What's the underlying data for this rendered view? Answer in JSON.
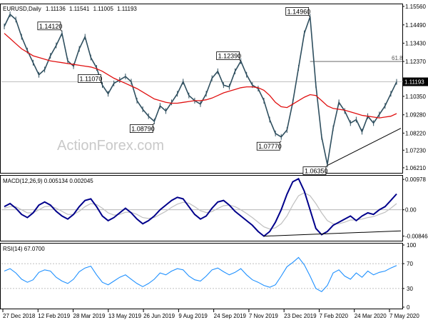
{
  "chart_data": [
    {
      "type": "candlestick",
      "title": "EURUSD,Daily",
      "ohlc": {
        "open": "1.11136",
        "high": "1.11541",
        "low": "1.11005",
        "close": "1.11193"
      },
      "y_ticks": [
        "1.15560",
        "1.14490",
        "1.13430",
        "1.12370",
        "1.11193",
        "1.10350",
        "1.09280",
        "1.08220",
        "1.07230",
        "1.06210"
      ],
      "ylim": [
        1.06,
        1.156
      ],
      "current_price": "1.11193",
      "fib_label": "61.8",
      "fib_level": 1.1237,
      "annotations": [
        {
          "label": "1.14120",
          "date_index": 2,
          "value": 1.1412
        },
        {
          "label": "1.11070",
          "date_index": 1,
          "value": 1.1107
        },
        {
          "label": "1.08790",
          "date_index": 6,
          "value": 1.0879
        },
        {
          "label": "1.12390",
          "date_index": 9,
          "value": 1.1239
        },
        {
          "label": "1.14960",
          "date_index": 11,
          "value": 1.1496
        },
        {
          "label": "1.07770",
          "date_index": 11,
          "value": 1.0777
        },
        {
          "label": "1.06350",
          "date_index": 12,
          "value": 1.0635
        }
      ],
      "series": [
        {
          "name": "",
          "kind": "price",
          "values": [
            1.144,
            1.151,
            1.148,
            1.138,
            1.13,
            1.123,
            1.116,
            1.119,
            1.127,
            1.133,
            1.14,
            1.124,
            1.121,
            1.131,
            1.138,
            1.126,
            1.12,
            1.11,
            1.105,
            1.111,
            1.113,
            1.115,
            1.112,
            1.101,
            1.096,
            1.092,
            1.089,
            1.098,
            1.095,
            1.1,
            1.105,
            1.112,
            1.104,
            1.101,
            1.099,
            1.105,
            1.114,
            1.118,
            1.11,
            1.109,
            1.118,
            1.1239,
            1.116,
            1.11,
            1.108,
            1.101,
            1.09,
            1.082,
            1.08,
            1.084,
            1.1,
            1.12,
            1.14,
            1.1496,
            1.11,
            1.08,
            1.064,
            1.085,
            1.1,
            1.095,
            1.088,
            1.09,
            1.083,
            1.092,
            1.088,
            1.093,
            1.098,
            1.105,
            1.1119
          ]
        },
        {
          "name": "",
          "kind": "moving-average",
          "values": [
            1.14,
            1.137,
            1.134,
            1.131,
            1.129,
            1.127,
            1.126,
            1.125,
            1.124,
            1.1235,
            1.123,
            1.1225,
            1.122,
            1.1215,
            1.121,
            1.1205,
            1.1195,
            1.118,
            1.116,
            1.114,
            1.1125,
            1.111,
            1.1095,
            1.108,
            1.106,
            1.104,
            1.102,
            1.101,
            1.1,
            1.0995,
            1.0995,
            1.1,
            1.1005,
            1.101,
            1.101,
            1.1015,
            1.1025,
            1.104,
            1.1055,
            1.1065,
            1.1075,
            1.1085,
            1.109,
            1.109,
            1.1085,
            1.107,
            1.104,
            1.1,
            1.0975,
            1.097,
            1.099,
            1.101,
            1.103,
            1.1045,
            1.104,
            1.101,
            1.098,
            1.0965,
            1.096,
            1.0955,
            1.0945,
            1.0935,
            1.0925,
            1.092,
            1.0915,
            1.091,
            1.0915,
            1.092,
            1.0935
          ]
        }
      ]
    },
    {
      "type": "line",
      "title": "MACD(12,26,9) 0.005134 0.002045",
      "y_ticks": [
        "0.00978",
        "0.00",
        "-0.008464"
      ],
      "ylim": [
        -0.0095,
        0.0105
      ],
      "series": [
        {
          "name": "",
          "kind": "macd",
          "values": [
            0.001,
            0.002,
            0.0005,
            -0.0015,
            -0.0025,
            -0.001,
            0.0015,
            0.0025,
            0.0015,
            -0.0005,
            -0.002,
            -0.003,
            -0.0015,
            0.001,
            0.003,
            0.0035,
            0.001,
            -0.002,
            -0.0035,
            -0.0025,
            -0.001,
            0.0005,
            -0.001,
            -0.003,
            -0.0045,
            -0.0035,
            -0.002,
            0.0,
            0.0015,
            0.003,
            0.004,
            0.0035,
            0.001,
            -0.0015,
            -0.003,
            -0.002,
            0.0005,
            0.0025,
            0.003,
            0.0015,
            -0.0005,
            -0.002,
            -0.0035,
            -0.005,
            -0.007,
            -0.0085,
            -0.007,
            -0.004,
            0.0,
            0.005,
            0.009,
            0.01,
            0.006,
            0.0,
            -0.006,
            -0.008,
            -0.007,
            -0.005,
            -0.004,
            -0.003,
            -0.002,
            -0.0035,
            -0.002,
            -0.001,
            -0.0015,
            0.0,
            0.001,
            0.003,
            0.0051
          ]
        },
        {
          "name": "",
          "kind": "signal",
          "values": [
            0.0005,
            0.001,
            0.001,
            0.0,
            -0.001,
            -0.001,
            0.0,
            0.001,
            0.0012,
            0.0005,
            -0.0005,
            -0.0015,
            -0.0015,
            -0.0005,
            0.001,
            0.002,
            0.0017,
            0.0005,
            -0.001,
            -0.0017,
            -0.0015,
            -0.0008,
            -0.0008,
            -0.0015,
            -0.0025,
            -0.0028,
            -0.0025,
            -0.0015,
            -0.0005,
            0.0008,
            0.0018,
            0.0024,
            0.0021,
            0.001,
            -0.0003,
            -0.0009,
            -0.0006,
            0.0004,
            0.0013,
            0.0015,
            0.001,
            0.0,
            -0.0012,
            -0.0025,
            -0.004,
            -0.0055,
            -0.0062,
            -0.0058,
            -0.0045,
            -0.002,
            0.0015,
            0.0045,
            0.0055,
            0.0045,
            0.002,
            -0.001,
            -0.0035,
            -0.0045,
            -0.0045,
            -0.004,
            -0.0033,
            -0.0033,
            -0.003,
            -0.0025,
            -0.0022,
            -0.0015,
            -0.0008,
            0.0005,
            0.002
          ]
        }
      ]
    },
    {
      "type": "line",
      "title": "RSI(14) 67.0700",
      "y_ticks": [
        "100",
        "70",
        "30",
        "0"
      ],
      "ylim": [
        0,
        100
      ],
      "series": [
        {
          "name": "",
          "kind": "rsi",
          "values": [
            58,
            62,
            55,
            45,
            40,
            44,
            56,
            60,
            58,
            48,
            42,
            38,
            45,
            57,
            63,
            66,
            52,
            40,
            36,
            42,
            48,
            52,
            45,
            38,
            33,
            38,
            45,
            55,
            52,
            58,
            62,
            60,
            50,
            44,
            42,
            50,
            60,
            63,
            57,
            52,
            56,
            62,
            52,
            44,
            40,
            35,
            32,
            36,
            50,
            65,
            72,
            80,
            68,
            50,
            30,
            25,
            35,
            55,
            60,
            50,
            45,
            55,
            48,
            58,
            52,
            56,
            58,
            63,
            67
          ]
        }
      ]
    }
  ],
  "x_ticks": [
    "27 Dec 2018",
    "12 Feb 2019",
    "28 Mar 2019",
    "13 May 2019",
    "26 Jun 2019",
    "9 Aug 2019",
    "24 Sep 2019",
    "7 Nov 2019",
    "23 Dec 2019",
    "7 Feb 2020",
    "24 Mar 2020",
    "7 May 2020"
  ],
  "watermark": "ActionForex.com",
  "colors": {
    "price": "#2f4f5f",
    "moving_average": "#e01010",
    "macd": "#00008b",
    "signal": "#c0c0c0",
    "rsi": "#1e90ff",
    "price_box": "#000000"
  }
}
